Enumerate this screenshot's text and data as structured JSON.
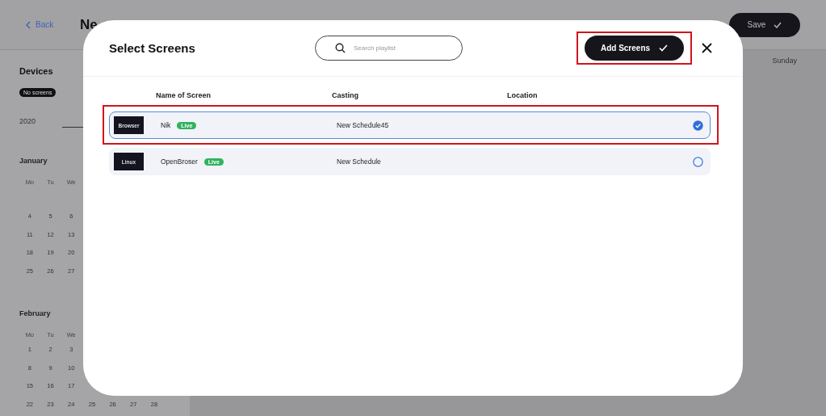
{
  "page": {
    "back_link": "Back",
    "title": "Ne",
    "save_button": "Save",
    "day_header": "Sunday"
  },
  "sidebar": {
    "heading": "Devices",
    "badge": "No screens",
    "year_tab": "2020",
    "months": [
      {
        "name": "January",
        "weekdays": [
          "Mo",
          "Tu",
          "We"
        ],
        "weeks": [
          [
            "4",
            "5",
            "6"
          ],
          [
            "11",
            "12",
            "13"
          ],
          [
            "18",
            "19",
            "20"
          ],
          [
            "25",
            "26",
            "27"
          ]
        ]
      },
      {
        "name": "February",
        "weekdays": [
          "Mo",
          "Tu",
          "We"
        ],
        "weeks": [
          [
            "1",
            "2",
            "3"
          ],
          [
            "8",
            "9",
            "10"
          ],
          [
            "15",
            "16",
            "17"
          ],
          [
            "22",
            "23",
            "24",
            "25",
            "26",
            "27",
            "28"
          ]
        ]
      }
    ]
  },
  "dialog": {
    "title": "Select Screens",
    "search": {
      "placeholder": "Search playlist"
    },
    "add_button": {
      "label": "Add Screens",
      "highlighted": true
    },
    "columns": [
      "Name of Screen",
      "Casting",
      "Location"
    ],
    "rows": [
      {
        "thumbnail": "Browser",
        "name": "Nik",
        "status": "Live",
        "casting": "New Schedule45",
        "selected": true,
        "highlighted": true
      },
      {
        "thumbnail": "Linux",
        "name": "OpenBroser",
        "status": "Live",
        "casting": "New Schedule",
        "selected": false,
        "highlighted": false
      }
    ]
  }
}
